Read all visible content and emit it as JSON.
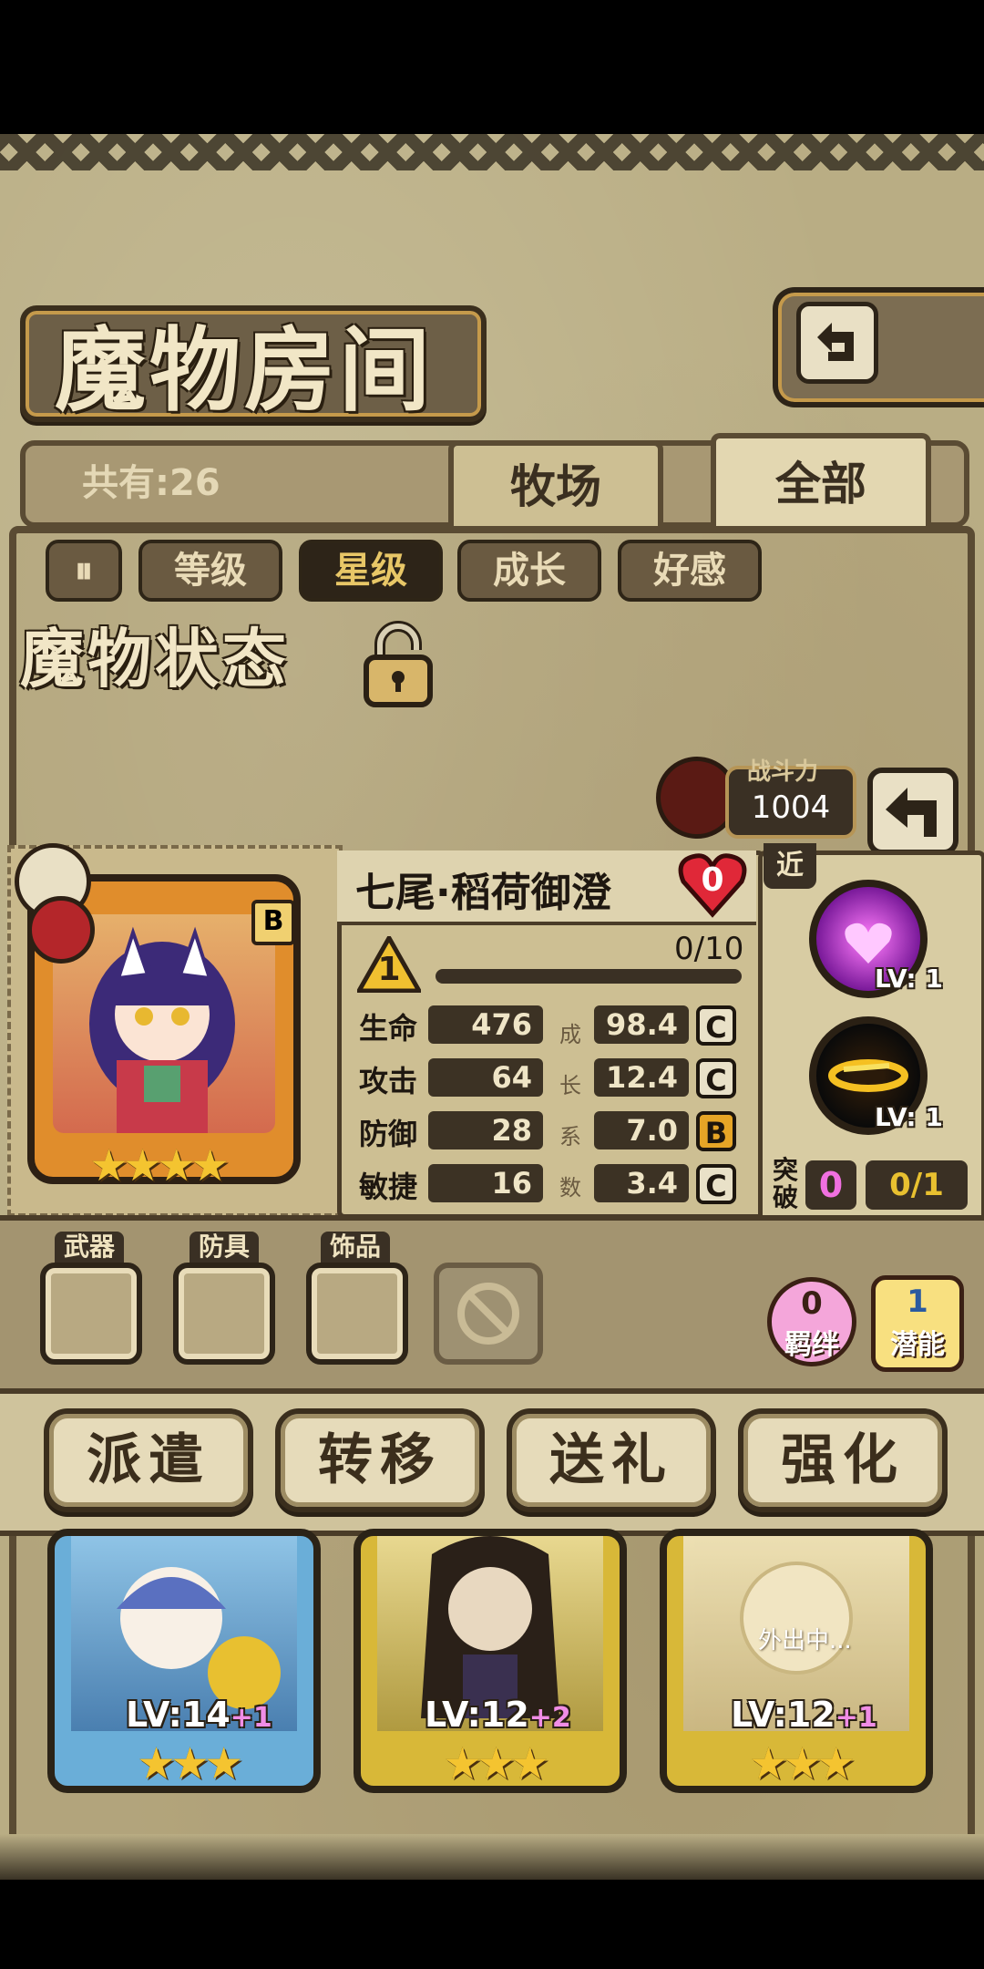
{
  "header": {
    "title": "魔物房间",
    "back_icon": "return-icon"
  },
  "tabs": [
    {
      "label": "牧场"
    },
    {
      "label": "全部"
    }
  ],
  "count_label": "共有:26",
  "sort_buttons": [
    "等级",
    "星级",
    "成长",
    "好感"
  ],
  "sort_active": "星级",
  "status_panel": {
    "title": "魔物状态",
    "power_label": "战斗力",
    "power_value": "1004",
    "monster_name": "七尾·稻荷御澄",
    "heart_value": "0",
    "rank_badge": "B",
    "level_badge": "1",
    "exp_text": "0/10",
    "range_tag": "近",
    "growth_chars": [
      "成",
      "长",
      "系",
      "数"
    ],
    "stats": [
      {
        "label": "生命",
        "value": "476",
        "growth": "98.4",
        "grade": "C"
      },
      {
        "label": "攻击",
        "value": "64",
        "growth": "12.4",
        "grade": "C"
      },
      {
        "label": "防御",
        "value": "28",
        "growth": "7.0",
        "grade": "B"
      },
      {
        "label": "敏捷",
        "value": "16",
        "growth": "3.4",
        "grade": "C"
      }
    ],
    "skills": [
      {
        "name": "hearts-skill-icon",
        "level": "LV: 1"
      },
      {
        "name": "ring-skill-icon",
        "level": "LV: 1"
      }
    ],
    "breakthrough_label_1": "突",
    "breakthrough_label_2": "破",
    "breakthrough_value": "0",
    "breakthrough_progress": "0/1",
    "stars": 4
  },
  "equipment": [
    {
      "label": "武器"
    },
    {
      "label": "防具"
    },
    {
      "label": "饰品"
    }
  ],
  "bond": {
    "value": "0",
    "label": "羁绊"
  },
  "potential": {
    "value": "1",
    "label": "潜能"
  },
  "actions": [
    "派遣",
    "转移",
    "送礼",
    "强化"
  ],
  "cards": [
    {
      "level": "LV:14",
      "plus": "+1",
      "stars": 3,
      "color": "#5aa2cf"
    },
    {
      "level": "LV:12",
      "plus": "+2",
      "stars": 3,
      "color": "#d4b23a"
    },
    {
      "level": "LV:12",
      "plus": "+1",
      "stars": 3,
      "color": "#d4b23a",
      "status": "外出中..."
    }
  ]
}
